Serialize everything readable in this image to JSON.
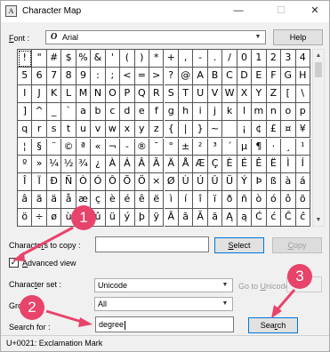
{
  "window": {
    "title": "Character Map",
    "minimize": "—",
    "maximize": "☐",
    "close": "✕"
  },
  "font": {
    "label_prefix": "",
    "label_ul": "F",
    "label_rest": "ont :",
    "value": "Arial",
    "font_icon_glyph": "O"
  },
  "help_button": "Help",
  "characters": [
    "!",
    "\"",
    "#",
    "$",
    "%",
    "&",
    "'",
    "(",
    ")",
    "*",
    "+",
    ",",
    "-",
    ".",
    "/",
    "0",
    "1",
    "2",
    "3",
    "4",
    "5",
    "6",
    "7",
    "8",
    "9",
    ":",
    ";",
    "<",
    "=",
    ">",
    "?",
    "@",
    "A",
    "B",
    "C",
    "D",
    "E",
    "F",
    "G",
    "H",
    "I",
    "J",
    "K",
    "L",
    "M",
    "N",
    "O",
    "P",
    "Q",
    "R",
    "S",
    "T",
    "U",
    "V",
    "W",
    "X",
    "Y",
    "Z",
    "[",
    "\\",
    "]",
    "^",
    "_",
    "`",
    "a",
    "b",
    "c",
    "d",
    "e",
    "f",
    "g",
    "h",
    "i",
    "j",
    "k",
    "l",
    "m",
    "n",
    "o",
    "p",
    "q",
    "r",
    "s",
    "t",
    "u",
    "v",
    "w",
    "x",
    "y",
    "z",
    "{",
    "|",
    "}",
    "~",
    " ",
    "¡",
    "¢",
    "£",
    "¤",
    "¥",
    "¦",
    "§",
    "¨",
    "©",
    "ª",
    "«",
    "¬",
    "-",
    "®",
    "¯",
    "°",
    "±",
    "²",
    "³",
    "´",
    "µ",
    "¶",
    "·",
    "¸",
    "¹",
    "º",
    "»",
    "¼",
    "½",
    "¾",
    "¿",
    "À",
    "Á",
    "Â",
    "Ã",
    "Ä",
    "Å",
    "Æ",
    "Ç",
    "È",
    "É",
    "Ê",
    "Ë",
    "Ì",
    "Í",
    "Î",
    "Ï",
    "Ð",
    "Ñ",
    "Ò",
    "Ó",
    "Ô",
    "Õ",
    "Ö",
    "×",
    "Ø",
    "Ù",
    "Ú",
    "Û",
    "Ü",
    "Ý",
    "Þ",
    "ß",
    "à",
    "á",
    "â",
    "ã",
    "ä",
    "å",
    "æ",
    "ç",
    "è",
    "é",
    "ê",
    "ë",
    "ì",
    "í",
    "î",
    "ï",
    "ð",
    "ñ",
    "ò",
    "ó",
    "ô",
    "õ",
    "ö",
    "÷",
    "ø",
    "ù",
    "ú",
    "û",
    "ü",
    "ý",
    "þ",
    "ÿ",
    "Ā",
    "ā",
    "Ă",
    "ă",
    "Ą",
    "ą",
    "Ć",
    "ć",
    "Ĉ",
    "ĉ"
  ],
  "characters_to_copy": {
    "label_pre": "Characte",
    "label_ul": "r",
    "label_rest": "s to copy :",
    "value": ""
  },
  "select_button": {
    "ul": "S",
    "rest": "elect"
  },
  "copy_button": {
    "ul": "C",
    "rest": "opy"
  },
  "advanced_view": {
    "label_ul": "A",
    "label_rest": "dvanced view",
    "checked": "✓"
  },
  "character_set": {
    "label_pre": "Charac",
    "label_ul": "t",
    "label_rest": "er set :",
    "value": "Unicode"
  },
  "go_to_unicode": {
    "pre": "Go to ",
    "ul": "U",
    "rest": "nicode :"
  },
  "group_by": {
    "label_pre": "Gro",
    "label_rest": "",
    "value": "All"
  },
  "search_for": {
    "label": "Search for :",
    "value": "degree"
  },
  "search_button": {
    "pre": "Sea",
    "ul": "r",
    "rest": "ch"
  },
  "status": "U+0021: Exclamation Mark",
  "badges": [
    "1",
    "2",
    "3"
  ],
  "colors": {
    "accent": "#e8436a",
    "focus_border": "#0078d7"
  }
}
